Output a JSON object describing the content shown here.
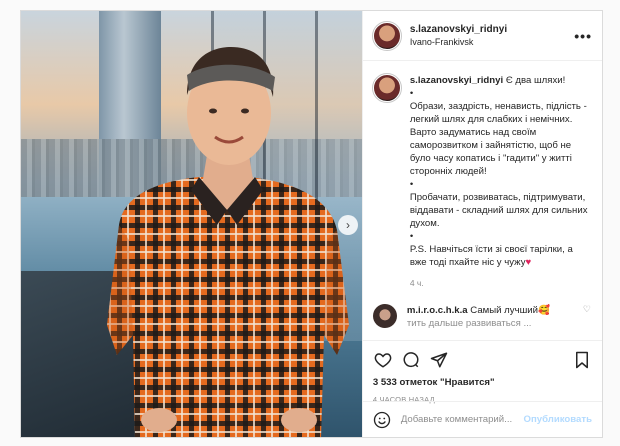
{
  "post": {
    "author": "s.lazanovskyi_ridnyi",
    "location": "Ivano-Frankivsk",
    "more_icon": "more-dots-icon",
    "caption": {
      "username": "s.lazanovskyi_ridnyi",
      "intro": "Є два шляхи!",
      "bullet1": "•",
      "para1": "Образи, заздрість, ненависть, підлість - легкий шлях для слабких і немічних. Варто задуматись над своїм саморозвитком і зайнятістю, щоб не було часу копатись і \"гадити\" у житті сторонніх людей!",
      "bullet2": "•",
      "para2": "Пробачати, розвиватась, підтримувати, віддавати - складний шлях для сильних духом.",
      "bullet3": "•",
      "para3": "P.S. Навчіться їсти зі своєї тарілки, а вже тоді пхайте ніс у чужу",
      "time": "4 ч."
    },
    "reply": {
      "username": "m.i.r.o.c.h.k.a",
      "text": "Самый лучший",
      "continuation": "тить дальше развиваться ..."
    },
    "likes": "3 533 отметок \"Нравится\"",
    "posted_ago": "4 ЧАСОВ НАЗАД",
    "add_comment_placeholder": "Добавьте комментарий...",
    "publish_label": "Опубликовать"
  },
  "colors": {
    "accent_blue_disabled": "#b3dbff",
    "heart_red": "#e0245e",
    "muted_text": "#8e8e8e"
  }
}
